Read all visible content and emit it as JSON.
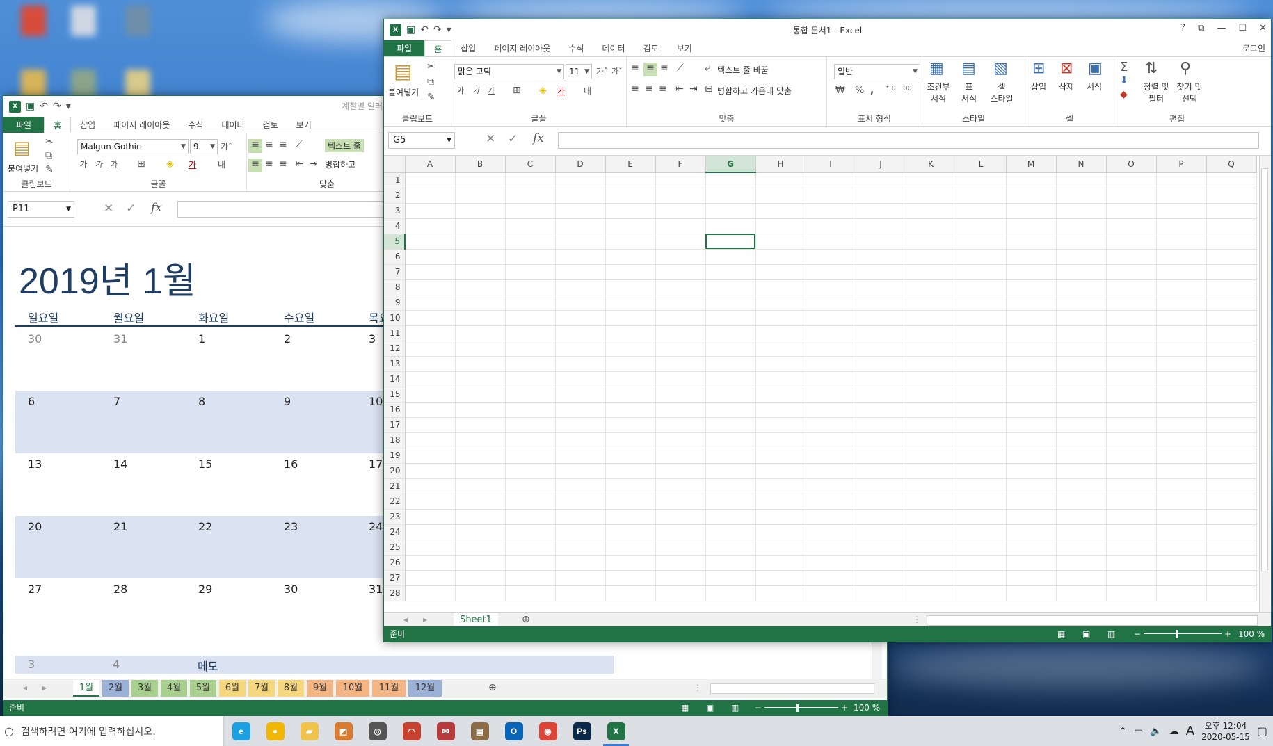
{
  "colors": {
    "excel_green": "#217346",
    "calendar_text": "#1f3d62",
    "calendar_shade": "#dbe2f1",
    "taskbar": "#dcdfe4"
  },
  "back_window": {
    "title": "계절별 일러",
    "tabs": [
      "파일",
      "홈",
      "삽입",
      "페이지 레이아웃",
      "수식",
      "데이터",
      "검토",
      "보기"
    ],
    "active_tab": "홈",
    "ribbon": {
      "paste": "붙여넣기",
      "font_name": "Malgun Gothic",
      "font_size": "9",
      "wrap_text": "텍스트 줄",
      "merge": "병합하고",
      "groups": {
        "clipboard": "클립보드",
        "font": "글꼴",
        "alignment": "맞춤"
      }
    },
    "name_box": "P11",
    "fx": "fx",
    "calendar": {
      "title": "2019년 1월",
      "weekdays": [
        "일요일",
        "월요일",
        "화요일",
        "수요일",
        "목요일"
      ],
      "weeks": [
        [
          "30",
          "31",
          "1",
          "2",
          "3"
        ],
        [
          "6",
          "7",
          "8",
          "9",
          "10"
        ],
        [
          "13",
          "14",
          "15",
          "16",
          "17"
        ],
        [
          "20",
          "21",
          "22",
          "23",
          "24"
        ],
        [
          "27",
          "28",
          "29",
          "30",
          "31"
        ]
      ],
      "extra_row": [
        "3",
        "4"
      ],
      "memo": "메모"
    },
    "sheet_tabs": [
      "1월",
      "2월",
      "3월",
      "4월",
      "5월",
      "6월",
      "7월",
      "8월",
      "9월",
      "10월",
      "11월",
      "12월"
    ],
    "sheet_tab_colors": [
      "#ffffff",
      "#9bb1d6",
      "#a9cf8f",
      "#a9cf8f",
      "#a9cf8f",
      "#f5d77e",
      "#f5d77e",
      "#f5d77e",
      "#f3b584",
      "#f3b584",
      "#f3b584",
      "#9bb1d6"
    ],
    "status": "준비",
    "zoom": "100 %"
  },
  "front_window": {
    "title": "통합 문서1 - Excel",
    "login": "로그인",
    "tabs": [
      "파일",
      "홈",
      "삽입",
      "페이지 레이아웃",
      "수식",
      "데이터",
      "검토",
      "보기"
    ],
    "active_tab": "홈",
    "ribbon": {
      "paste": "붙여넣기",
      "font_name": "맑은 고딕",
      "font_size": "11",
      "wrap_text": "텍스트 줄 바꿈",
      "merge_center": "병합하고 가운데 맞춤",
      "number_format": "일반",
      "conditional": [
        "조건부",
        "서식"
      ],
      "table_format": [
        "표",
        "서식"
      ],
      "cell_style": [
        "셀",
        "스타일"
      ],
      "insert": "삽입",
      "delete": "삭제",
      "format": "서식",
      "sort_filter": [
        "정렬 및",
        "필터"
      ],
      "find_select": [
        "찾기 및",
        "선택"
      ],
      "groups": {
        "clipboard": "클립보드",
        "font": "글꼴",
        "alignment": "맞춤",
        "number": "표시 형식",
        "styles": "스타일",
        "cells": "셀",
        "editing": "편집"
      }
    },
    "name_box": "G5",
    "fx": "fx",
    "columns": [
      "A",
      "B",
      "C",
      "D",
      "E",
      "F",
      "G",
      "H",
      "I",
      "J",
      "K",
      "L",
      "M",
      "N",
      "O",
      "P",
      "Q"
    ],
    "rows": [
      "1",
      "2",
      "3",
      "4",
      "5",
      "6",
      "7",
      "8",
      "9",
      "10",
      "11",
      "12",
      "13",
      "14",
      "15",
      "16",
      "17",
      "18",
      "19",
      "20",
      "21",
      "22",
      "23",
      "24",
      "25",
      "26",
      "27",
      "28"
    ],
    "selected_cell": "G5",
    "sheet_tab": "Sheet1",
    "status": "준비",
    "zoom": "100 %"
  },
  "taskbar": {
    "search_placeholder": "검색하려면 여기에 입력하십시오.",
    "apps": [
      {
        "name": "internet-explorer",
        "label": "e",
        "color": "#1ba1e2"
      },
      {
        "name": "messenger",
        "label": "●",
        "color": "#f2b705"
      },
      {
        "name": "file-explorer",
        "label": "▰",
        "color": "#f0c24b"
      },
      {
        "name": "sticky-app",
        "label": "◩",
        "color": "#d97b2e"
      },
      {
        "name": "search-app",
        "label": "◎",
        "color": "#555555"
      },
      {
        "name": "wifi-app",
        "label": "◠",
        "color": "#c8412f"
      },
      {
        "name": "mail-app",
        "label": "✉",
        "color": "#b83b3b"
      },
      {
        "name": "archive-app",
        "label": "▤",
        "color": "#8c6d46"
      },
      {
        "name": "outlook",
        "label": "O",
        "color": "#0a64b5"
      },
      {
        "name": "chrome",
        "label": "◉",
        "color": "#db4437"
      },
      {
        "name": "photoshop",
        "label": "Ps",
        "color": "#0b2a4a"
      },
      {
        "name": "excel",
        "label": "X",
        "color": "#217346"
      }
    ],
    "time": "오후 12:04",
    "date": "2020-05-15",
    "ime": "A"
  }
}
